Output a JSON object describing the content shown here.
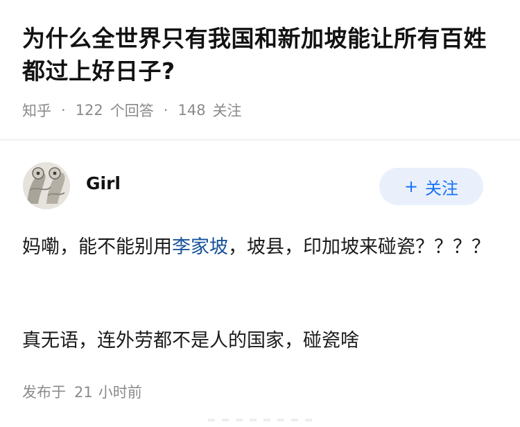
{
  "question": {
    "title": "为什么全世界只有我国和新加坡能让所有百姓都过上好日子?",
    "source": "知乎",
    "answer_count": "122",
    "answers_label": "个回答",
    "follower_count": "148",
    "followers_label": "关注"
  },
  "answer": {
    "author_name": "Girl",
    "follow_label": "关注",
    "follow_icon": "plus-icon",
    "para1_before": "妈嘞，能不能别用",
    "para1_link": "李家坡",
    "para1_after": "，坡县，印加坡来碰瓷？？？？",
    "para2": "真无语，连外劳都不是人的国家，碰瓷啥",
    "posted_prefix": "发布于",
    "posted_num": "21",
    "posted_suffix": "小时前"
  },
  "colors": {
    "accent": "#1772f6",
    "link": "#175199",
    "muted": "#8a8a8a"
  }
}
